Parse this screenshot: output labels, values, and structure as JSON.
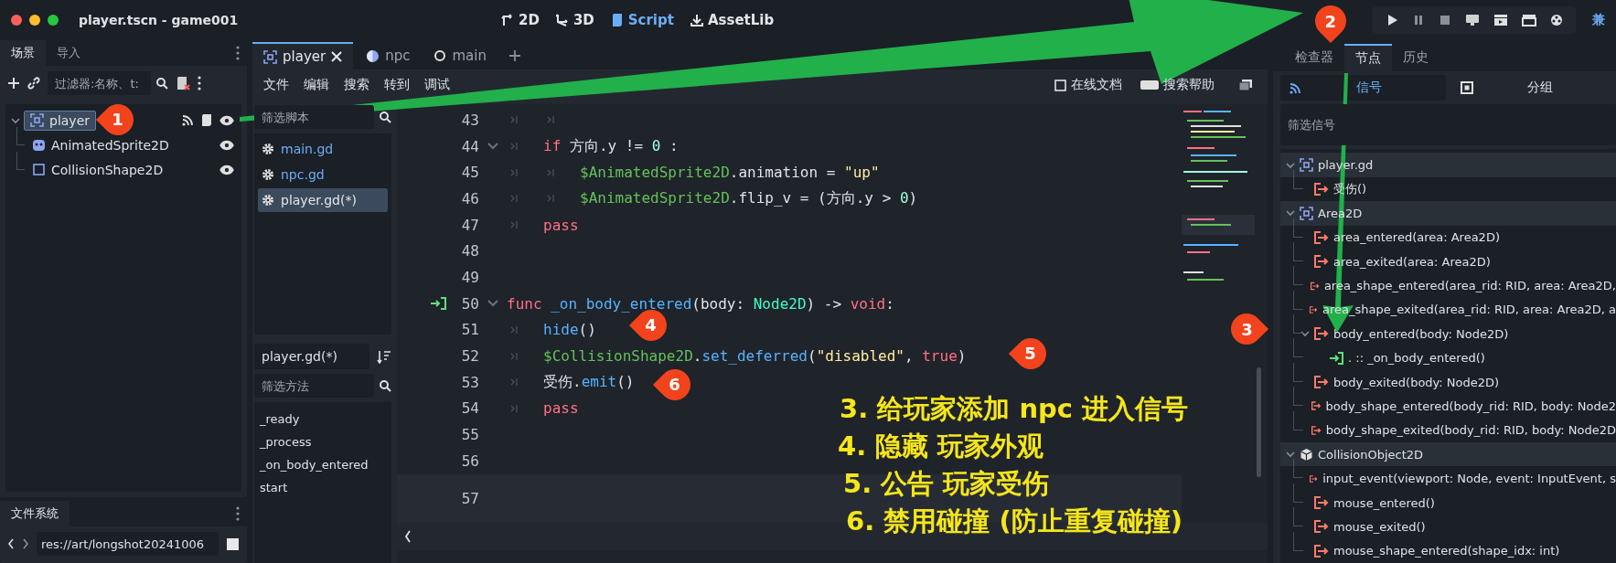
{
  "window": {
    "title": "player.tscn - game001"
  },
  "workspaces": [
    {
      "label": "2D",
      "kind": "planar",
      "selected": false
    },
    {
      "label": "3D",
      "kind": "spatial",
      "selected": false
    },
    {
      "label": "Script",
      "kind": "script",
      "selected": true
    },
    {
      "label": "AssetLib",
      "kind": "assetlib",
      "selected": false
    }
  ],
  "renderer_label": "兼",
  "scene_dock": {
    "tabs": [
      {
        "label": "场景",
        "selected": true
      },
      {
        "label": "导入",
        "selected": false
      }
    ],
    "filter": {
      "placeholder": "过滤器:名称、t:"
    },
    "tree": [
      {
        "name": "player",
        "kind": "area",
        "selected": true,
        "expanded": true,
        "has_signals": true,
        "has_script": true,
        "visible": true,
        "children": [
          {
            "name": "AnimatedSprite2D",
            "kind": "sprite",
            "selected": false,
            "visible": true
          },
          {
            "name": "CollisionShape2D",
            "kind": "shape",
            "selected": false,
            "visible": true
          }
        ]
      }
    ]
  },
  "filesystem": {
    "tab": "文件系统",
    "path": "res://art/longshot20241006"
  },
  "editor_tabs": [
    {
      "label": "player",
      "kind": "scene",
      "selected": true
    },
    {
      "label": "npc",
      "kind": "globe",
      "selected": false
    },
    {
      "label": "main",
      "kind": "circle",
      "selected": false
    }
  ],
  "script_menu": [
    "文件",
    "编辑",
    "搜索",
    "转到",
    "调试"
  ],
  "help_buttons": [
    "在线文档",
    "搜索帮助"
  ],
  "scripts": {
    "filter": {
      "placeholder": "筛选脚本"
    },
    "items": [
      {
        "name": "main.gd",
        "selected": false
      },
      {
        "name": "npc.gd",
        "selected": false
      },
      {
        "name": "player.gd(*)",
        "selected": true
      }
    ],
    "current": "player.gd(*)",
    "method_filter": {
      "placeholder": "筛选方法"
    },
    "methods": [
      "_ready",
      "_process",
      "_on_body_entered",
      "start"
    ]
  },
  "code": {
    "lines": [
      {
        "num": "43",
        "foldable": false,
        "signal": false,
        "current": false,
        "tokens": [
          {
            "kind": "tab"
          },
          {
            "kind": "tab"
          }
        ]
      },
      {
        "num": "44",
        "foldable": true,
        "signal": false,
        "current": false,
        "tokens": [
          {
            "kind": "tab"
          },
          {
            "kind": "keyword",
            "text": "if"
          },
          {
            "kind": "plain",
            "text": " 方向.y != "
          },
          {
            "kind": "number",
            "text": "0"
          },
          {
            "kind": "plain",
            "text": " :"
          }
        ]
      },
      {
        "num": "45",
        "foldable": false,
        "signal": false,
        "current": false,
        "tokens": [
          {
            "kind": "tab"
          },
          {
            "kind": "tab"
          },
          {
            "kind": "node",
            "text": "$AnimatedSprite2D"
          },
          {
            "kind": "plain",
            "text": ".animation = "
          },
          {
            "kind": "string",
            "text": "\"up\""
          }
        ]
      },
      {
        "num": "46",
        "foldable": false,
        "signal": false,
        "current": false,
        "tokens": [
          {
            "kind": "tab"
          },
          {
            "kind": "tab"
          },
          {
            "kind": "node",
            "text": "$AnimatedSprite2D"
          },
          {
            "kind": "plain",
            "text": ".flip_v = (方向.y > "
          },
          {
            "kind": "number",
            "text": "0"
          },
          {
            "kind": "plain",
            "text": ")"
          }
        ]
      },
      {
        "num": "47",
        "foldable": false,
        "signal": false,
        "current": false,
        "tokens": [
          {
            "kind": "tab"
          },
          {
            "kind": "keyword",
            "text": "pass"
          }
        ]
      },
      {
        "num": "48",
        "foldable": false,
        "signal": false,
        "current": false
      },
      {
        "num": "49",
        "foldable": false,
        "signal": false,
        "current": false
      },
      {
        "num": "50",
        "foldable": true,
        "signal": true,
        "current": false,
        "tokens": [
          {
            "kind": "keyword",
            "text": "func"
          },
          {
            "kind": "func",
            "text": " _on_body_entered"
          },
          {
            "kind": "plain",
            "text": "(body: "
          },
          {
            "kind": "type",
            "text": "Node2D"
          },
          {
            "kind": "plain",
            "text": ") -> "
          },
          {
            "kind": "keyword",
            "text": "void"
          },
          {
            "kind": "plain",
            "text": ":"
          }
        ]
      },
      {
        "num": "51",
        "foldable": false,
        "signal": false,
        "current": false,
        "tokens": [
          {
            "kind": "tab"
          },
          {
            "kind": "func",
            "text": "hide"
          },
          {
            "kind": "plain",
            "text": "()"
          }
        ]
      },
      {
        "num": "52",
        "foldable": false,
        "signal": false,
        "current": false,
        "tokens": [
          {
            "kind": "tab"
          },
          {
            "kind": "node",
            "text": "$CollisionShape2D"
          },
          {
            "kind": "plain",
            "text": "."
          },
          {
            "kind": "func",
            "text": "set_deferred"
          },
          {
            "kind": "plain",
            "text": "("
          },
          {
            "kind": "string",
            "text": "\"disabled\""
          },
          {
            "kind": "plain",
            "text": ", "
          },
          {
            "kind": "keyword",
            "text": "true"
          },
          {
            "kind": "plain",
            "text": ")"
          }
        ]
      },
      {
        "num": "53",
        "foldable": false,
        "signal": false,
        "current": false,
        "tokens": [
          {
            "kind": "tab"
          },
          {
            "kind": "plain",
            "text": "受伤."
          },
          {
            "kind": "func",
            "text": "emit"
          },
          {
            "kind": "plain",
            "text": "()"
          }
        ]
      },
      {
        "num": "54",
        "foldable": false,
        "signal": false,
        "current": false,
        "tokens": [
          {
            "kind": "tab"
          },
          {
            "kind": "keyword",
            "text": "pass"
          }
        ]
      },
      {
        "num": "55",
        "foldable": false,
        "signal": false,
        "current": false
      },
      {
        "num": "56",
        "foldable": false,
        "signal": false,
        "current": false
      },
      {
        "num": "57",
        "foldable": false,
        "signal": false,
        "current": true
      }
    ]
  },
  "node_dock": {
    "tabs": [
      {
        "label": "检查器",
        "selected": false
      },
      {
        "label": "节点",
        "selected": true
      },
      {
        "label": "历史",
        "selected": false
      }
    ],
    "subtabs": [
      {
        "label": "信号",
        "kind": "signal",
        "selected": true
      },
      {
        "label": "分组",
        "kind": "group",
        "selected": false
      }
    ],
    "filter": {
      "placeholder": "筛选信号"
    },
    "tree": [
      {
        "name": "player.gd",
        "kind": "area",
        "expanded": true,
        "children": [
          {
            "name": "受伤()",
            "kind": "signal"
          }
        ]
      },
      {
        "name": "Area2D",
        "kind": "area",
        "expanded": true,
        "children": [
          {
            "name": "area_entered(area: Area2D)",
            "kind": "signal"
          },
          {
            "name": "area_exited(area: Area2D)",
            "kind": "signal"
          },
          {
            "name": "area_shape_entered(area_rid: RID, area: Area2D,",
            "kind": "signal"
          },
          {
            "name": "area_shape_exited(area_rid: RID, area: Area2D, a",
            "kind": "signal"
          },
          {
            "name": "body_entered(body: Node2D)",
            "kind": "signal",
            "expanded": true,
            "children": [
              {
                "name": ". :: _on_body_entered()",
                "kind": "connection"
              }
            ]
          },
          {
            "name": "body_exited(body: Node2D)",
            "kind": "signal"
          },
          {
            "name": "body_shape_entered(body_rid: RID, body: Node2",
            "kind": "signal"
          },
          {
            "name": "body_shape_exited(body_rid: RID, body: Node2D",
            "kind": "signal"
          }
        ]
      },
      {
        "name": "CollisionObject2D",
        "kind": "object",
        "expanded": true,
        "children": [
          {
            "name": "input_event(viewport: Node, event: InputEvent, s",
            "kind": "signal"
          },
          {
            "name": "mouse_entered()",
            "kind": "signal"
          },
          {
            "name": "mouse_exited()",
            "kind": "signal"
          },
          {
            "name": "mouse_shape_entered(shape_idx: int)",
            "kind": "signal"
          }
        ]
      }
    ]
  },
  "markers": [
    {
      "label": "1"
    },
    {
      "label": "2"
    },
    {
      "label": "3"
    },
    {
      "label": "4"
    },
    {
      "label": "5"
    },
    {
      "label": "6"
    }
  ],
  "annotations": [
    "3. 给玩家添加 npc 进入信号",
    "4. 隐藏 玩家外观",
    "5. 公告 玩家受伤",
    "6. 禁用碰撞 (防止重复碰撞)"
  ]
}
